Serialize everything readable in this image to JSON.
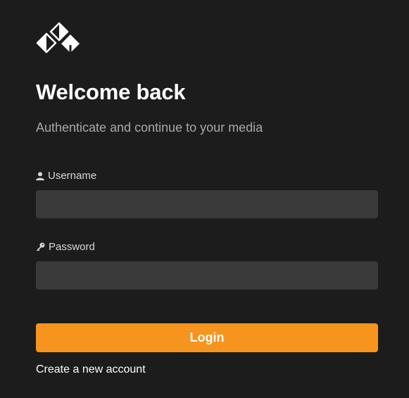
{
  "logo": {
    "icon": "app-logo-icon"
  },
  "header": {
    "title": "Welcome back",
    "subtitle": "Authenticate and continue to your media"
  },
  "form": {
    "username": {
      "label": "Username",
      "icon": "user-icon",
      "value": "",
      "placeholder": ""
    },
    "password": {
      "label": "Password",
      "icon": "key-icon",
      "value": "",
      "placeholder": ""
    },
    "login_label": "Login",
    "create_account_label": "Create a new account"
  },
  "colors": {
    "background": "#1c1c1c",
    "input_background": "#3a3a3a",
    "accent": "#f7941d"
  }
}
